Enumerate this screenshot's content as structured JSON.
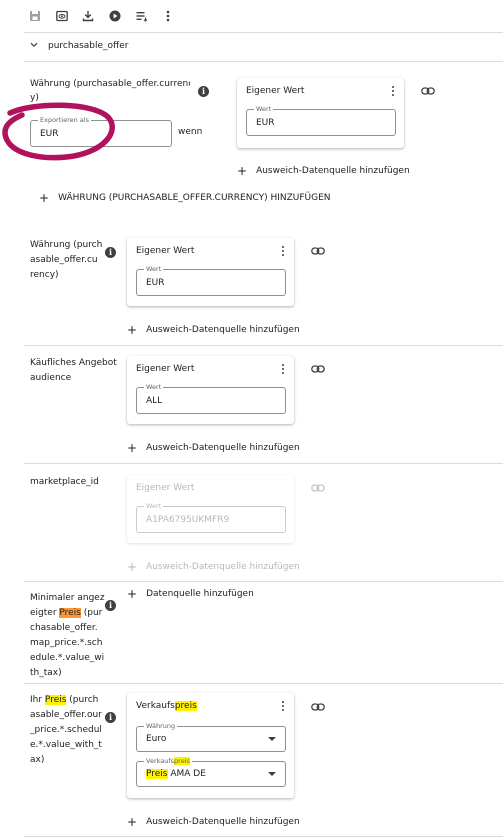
{
  "toolbar": {
    "icons": [
      "save-icon",
      "preview-icon",
      "download-icon",
      "play-icon",
      "reorder-icon",
      "more-vert-icon"
    ]
  },
  "section": {
    "title": "purchasable_offer"
  },
  "rows": {
    "currency_top": {
      "label": "Währung (purchasable_offer.currenc",
      "label_cont": "y)",
      "export_label": "Exportieren als",
      "export_value": "EUR",
      "wenn": "wenn",
      "card_title": "Eigener Wert",
      "field_label": "Wert",
      "field_value": "EUR",
      "fallback": "Ausweich-Datenquelle hinzufügen",
      "add_currency": "WÄHRUNG (PURCHASABLE_OFFER.CURRENCY) HINZUFÜGEN"
    },
    "currency": {
      "label_lines": [
        "Währung (purch",
        "asable_offer.cu",
        "rency)"
      ],
      "card_title": "Eigener Wert",
      "field_label": "Wert",
      "field_value": "EUR",
      "fallback": "Ausweich-Datenquelle hinzufügen"
    },
    "audience": {
      "label_lines": [
        "Käufliches Angebot",
        "audience"
      ],
      "card_title": "Eigener Wert",
      "field_label": "Wert",
      "field_value": "ALL",
      "fallback": "Ausweich-Datenquelle hinzufügen"
    },
    "marketplace": {
      "label": "marketplace_id",
      "card_title": "Eigener Wert",
      "field_label": "Wert",
      "field_value": "A1PA6795UKMFR9",
      "fallback": "Ausweich-Datenquelle hinzufügen"
    },
    "min_price": {
      "l1": "Minimaler angez",
      "l2_pre": "eigter ",
      "l2_hl": "Preis",
      "l2_post": " (pur",
      "l3": "chasable_offer.",
      "l4": "map_price.*.sch",
      "l5": "edule.*.value_wi",
      "l6": "th_tax)",
      "add_source": "Datenquelle hinzufügen"
    },
    "your_price": {
      "l1_pre": "Ihr ",
      "l1_hl": "Preis",
      "l1_post": " (purch",
      "l2": "asable_offer.our",
      "l3": "_price.*.schedul",
      "l4": "e.*.value_with_t",
      "l5": "ax)",
      "card_title_pre": "Verkaufs",
      "card_title_hl": "preis",
      "dd1_label": "Währung",
      "dd1_value": "Euro",
      "dd2_label_pre": "Verkaufs",
      "dd2_label_hl": "preis",
      "dd2_value_hl": "Preis",
      "dd2_value_post": " AMA DE",
      "fallback": "Ausweich-Datenquelle hinzufügen"
    }
  },
  "colors": {
    "highlight_yellow": "#fff200",
    "highlight_orange": "#ff9632",
    "annotation": "#b0125e"
  }
}
